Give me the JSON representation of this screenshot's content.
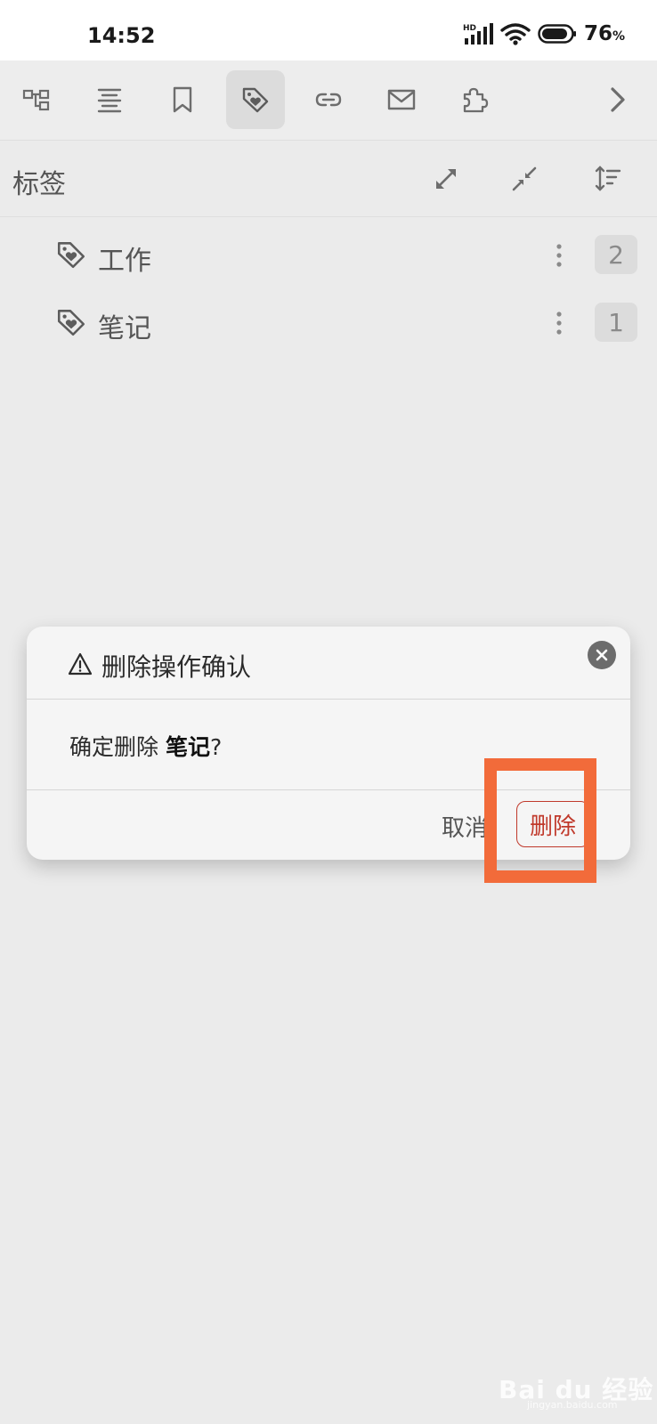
{
  "status_bar": {
    "time": "14:52",
    "network": "HD",
    "battery": "76",
    "battery_unit": "%"
  },
  "toolbar": {
    "buttons": [
      {
        "icon": "outline-tree-icon"
      },
      {
        "icon": "align-center-icon"
      },
      {
        "icon": "bookmark-icon"
      },
      {
        "icon": "tag-heart-icon",
        "active": true
      },
      {
        "icon": "link-icon"
      },
      {
        "icon": "mail-icon"
      },
      {
        "icon": "puzzle-icon"
      },
      {
        "icon": "chevron-right-icon"
      }
    ]
  },
  "panel": {
    "title": "标签",
    "actions": [
      "expand-icon",
      "collapse-icon",
      "sort-icon"
    ]
  },
  "tags": [
    {
      "label": "工作",
      "count": "2"
    },
    {
      "label": "笔记",
      "count": "1"
    }
  ],
  "dialog": {
    "title": "删除操作确认",
    "message_prefix": "确定删除 ",
    "message_target": "笔记",
    "message_suffix": "?",
    "cancel_label": "取消",
    "delete_label": "删除"
  },
  "highlight_color": "#f26b3a",
  "watermark": {
    "brand": "Bai du 经验",
    "url": "jingyan.baidu.com"
  }
}
